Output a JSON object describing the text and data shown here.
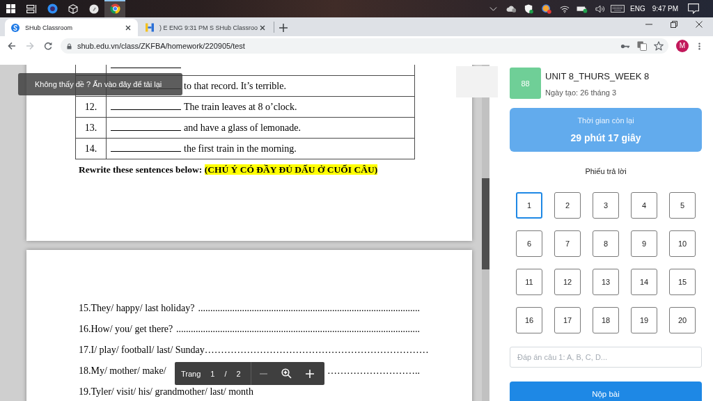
{
  "taskbar": {
    "buttons": [
      {
        "kind": "start"
      },
      {
        "kind": "task_view"
      }
    ],
    "apps": [
      {
        "kind": "ring",
        "active": false
      },
      {
        "kind": "cube",
        "active": false
      },
      {
        "kind": "disc",
        "active": false
      },
      {
        "kind": "browser",
        "active": true
      }
    ],
    "tray": {
      "language": "ENG",
      "time": "9:47 PM"
    }
  },
  "browser": {
    "tabs": [
      {
        "title": "SHub Classroom",
        "kind": "swirl",
        "selected": true
      },
      {
        "title": ") E ENG 9:31 PM S SHub Classroo",
        "kind": "bars",
        "selected": false
      }
    ],
    "forward_disabled": true,
    "address": "shub.edu.vn/class/ZKFBA/homework/220905/test",
    "profile_initial": "M"
  },
  "viewer": {
    "reload_hint": "Không thấy đề ? Ấn vào đây để tải lại",
    "table_rows": [
      {},
      {
        "text": "to that record. It’s terrible."
      },
      {
        "number": "12.",
        "text": "The train leaves at 8 o’clock."
      },
      {
        "number": "13.",
        "text": "and have a glass of lemonade."
      },
      {
        "number": "14.",
        "text": "the first train in the morning."
      }
    ],
    "instruction": "Rewrite these sentences below:",
    "instruction_note": "(CHÚ Ý CÓ ĐẦY ĐỦ DẤU Ở CUỐI CÂU)",
    "exercises": [
      {
        "prompt": "15.They/ happy/ last holiday?",
        "answer_line": "..........................................................................................."
      },
      {
        "prompt": "16.How/ you/ get there?",
        "answer_line": "...................................................................................................."
      },
      {
        "prompt": "17.I/ play/ football/ last/ Sunday",
        "answer_line": "……………………………………………………………"
      },
      {
        "prompt": "18.My/ mother/ make/",
        "answer_line": "……………………….."
      },
      {
        "prompt": "19.Tyler/ visit/ his/ grandmother/ last/ month"
      }
    ],
    "toolbar": {
      "page_label": "Trang",
      "current_page": "1",
      "separator": "/",
      "page_count": "2",
      "zoom_out_disabled": true
    }
  },
  "sidebar": {
    "score": "88",
    "title": "UNIT 8_THURS_WEEK 8",
    "created": "Ngày tạo: 26 tháng 3",
    "timer": {
      "label": "Thời gian còn lại",
      "remaining": "29 phút 17 giây"
    },
    "answer_sheet": {
      "title": "Phiếu trả lời",
      "questions": [
        {
          "label": "1",
          "selected": true
        },
        {
          "label": "2",
          "selected": false
        },
        {
          "label": "3",
          "selected": false
        },
        {
          "label": "4",
          "selected": false
        },
        {
          "label": "5",
          "selected": false
        },
        {
          "label": "6",
          "selected": false
        },
        {
          "label": "7",
          "selected": false
        },
        {
          "label": "8",
          "selected": false
        },
        {
          "label": "9",
          "selected": false
        },
        {
          "label": "10",
          "selected": false
        },
        {
          "label": "11",
          "selected": false
        },
        {
          "label": "12",
          "selected": false
        },
        {
          "label": "13",
          "selected": false
        },
        {
          "label": "14",
          "selected": false
        },
        {
          "label": "15",
          "selected": false
        },
        {
          "label": "16",
          "selected": false
        },
        {
          "label": "17",
          "selected": false
        },
        {
          "label": "18",
          "selected": false
        },
        {
          "label": "19",
          "selected": false
        },
        {
          "label": "20",
          "selected": false
        }
      ]
    },
    "answer_field": {
      "placeholder": "Đáp án câu 1: A, B, C, D..."
    },
    "submit": "Nộp bài"
  }
}
